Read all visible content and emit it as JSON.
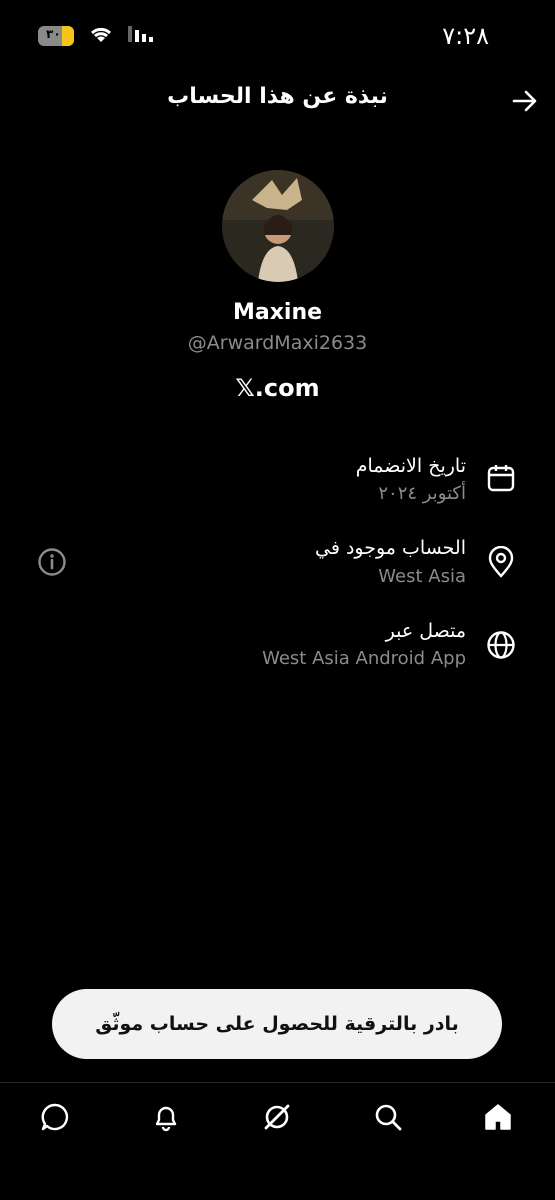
{
  "status_bar": {
    "time": "٧:٢٨",
    "battery": "٣٠",
    "icons": [
      "battery-icon",
      "wifi-icon",
      "signal-icon"
    ]
  },
  "header": {
    "title": "نبذة عن هذا الحساب",
    "back_icon": "arrow-right-icon"
  },
  "profile": {
    "name": "Maxine",
    "handle": "@ArwardMaxi2633",
    "site": "𝕏.com"
  },
  "info_rows": [
    {
      "icon": "calendar-icon",
      "title": "تاريخ الانضمام",
      "value": "أكتوبر ٢٠٢٤"
    },
    {
      "icon": "location-pin-icon",
      "title": "الحساب موجود في",
      "value": "West Asia",
      "extra_icon": "info-icon"
    },
    {
      "icon": "globe-icon",
      "title": "متصل عبر",
      "value": "West Asia Android App"
    }
  ],
  "upgrade_button": {
    "label": "بادر بالترقية للحصول على حساب موثّق"
  },
  "bottom_nav": [
    "home-icon",
    "search-icon",
    "grok-icon",
    "notifications-bell-icon",
    "messages-icon"
  ]
}
